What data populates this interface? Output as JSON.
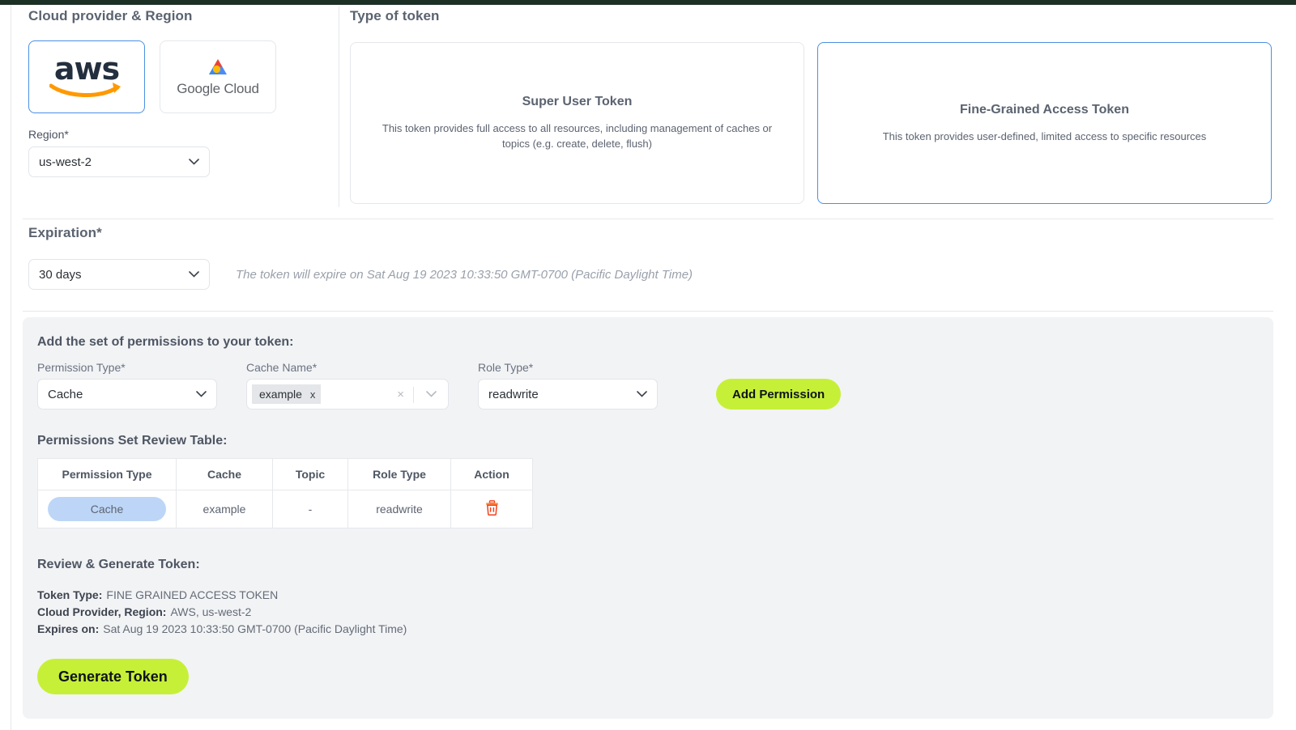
{
  "provider_section": {
    "heading": "Cloud provider & Region",
    "providers": [
      {
        "name": "aws",
        "label": "aws",
        "selected": true
      },
      {
        "name": "google-cloud",
        "label": "Google Cloud",
        "selected": false
      }
    ],
    "region_label": "Region*",
    "region_value": "us-west-2"
  },
  "token_type_section": {
    "heading": "Type of token",
    "cards": [
      {
        "title": "Super User Token",
        "description": "This token provides full access to all resources, including management of caches or topics (e.g. create, delete, flush)",
        "selected": false
      },
      {
        "title": "Fine-Grained Access Token",
        "description": "This token provides user-defined, limited access to specific resources",
        "selected": true
      }
    ]
  },
  "expiration_section": {
    "heading": "Expiration*",
    "value": "30 days",
    "note": "The token will expire on Sat Aug 19 2023 10:33:50 GMT-0700 (Pacific Daylight Time)"
  },
  "permissions_panel": {
    "title": "Add the set of permissions to your token:",
    "permission_type": {
      "label": "Permission Type*",
      "value": "Cache"
    },
    "cache_name": {
      "label": "Cache Name*",
      "chips": [
        "example"
      ],
      "chip_remove": "x",
      "clear_all": "×"
    },
    "role_type": {
      "label": "Role Type*",
      "value": "readwrite"
    },
    "add_button": "Add Permission",
    "table_title": "Permissions Set Review Table:",
    "table": {
      "columns": [
        "Permission Type",
        "Cache",
        "Topic",
        "Role Type",
        "Action"
      ],
      "rows": [
        {
          "permission_type": "Cache",
          "cache": "example",
          "topic": "-",
          "role_type": "readwrite",
          "action": "delete-icon"
        }
      ]
    },
    "review": {
      "title": "Review & Generate Token:",
      "items": [
        {
          "label": "Token Type:",
          "value": "FINE GRAINED ACCESS TOKEN"
        },
        {
          "label": "Cloud Provider, Region:",
          "value": "AWS, us-west-2"
        },
        {
          "label": "Expires on:",
          "value": "Sat Aug 19 2023 10:33:50 GMT-0700 (Pacific Daylight Time)"
        }
      ]
    },
    "generate_button": "Generate Token"
  },
  "colors": {
    "accent_green": "#c6f038",
    "selected_border": "#4a90e2",
    "panel_bg": "#f2f3f5",
    "pill_blue": "#bdd6f7",
    "trash_red": "#f1411c",
    "heading": "#5b6370"
  }
}
